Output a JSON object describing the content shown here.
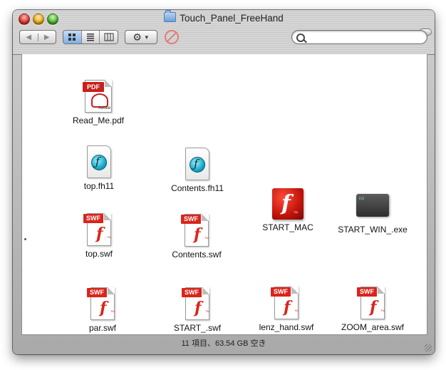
{
  "window": {
    "title": "Touch_Panel_FreeHand"
  },
  "toolbar": {
    "back_icon": "back-arrow-icon",
    "forward_icon": "forward-arrow-icon",
    "view_modes": [
      "icon-view",
      "list-view",
      "column-view"
    ],
    "action_icon": "gear-icon",
    "search_placeholder": ""
  },
  "files": [
    {
      "name": "Read_Me.pdf",
      "icon": "pdf-icon"
    },
    {
      "name": "top.fh11",
      "icon": "freehand-document-icon"
    },
    {
      "name": "Contents.fh11",
      "icon": "freehand-document-icon"
    },
    {
      "name": "START_MAC",
      "icon": "flash-app-icon"
    },
    {
      "name": "START_WIN_.exe",
      "icon": "exe-icon"
    },
    {
      "name": "top.swf",
      "icon": "swf-icon"
    },
    {
      "name": "Contents.swf",
      "icon": "swf-icon"
    },
    {
      "name": "par.swf",
      "icon": "swf-icon"
    },
    {
      "name": "START_.swf",
      "icon": "swf-icon"
    },
    {
      "name": "lenz_hand.swf",
      "icon": "swf-icon"
    },
    {
      "name": "ZOOM_area.swf",
      "icon": "swf-icon"
    }
  ],
  "status": {
    "text": "11 項目、63.54 GB 空き"
  }
}
